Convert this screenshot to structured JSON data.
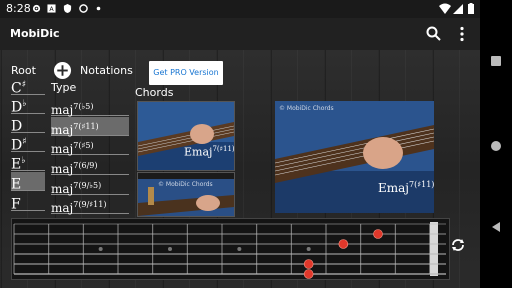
{
  "status": {
    "time": "8:28"
  },
  "app": {
    "title": "MobiDic"
  },
  "header": {
    "notations_label": "Notations",
    "pro_button": "Get PRO Version"
  },
  "roots": {
    "heading": "Root",
    "items": [
      {
        "letter": "C",
        "accidental": "♯"
      },
      {
        "letter": "D",
        "accidental": "♭"
      },
      {
        "letter": "D",
        "accidental": ""
      },
      {
        "letter": "D",
        "accidental": "♯"
      },
      {
        "letter": "E",
        "accidental": "♭"
      },
      {
        "letter": "E",
        "accidental": ""
      },
      {
        "letter": "F",
        "accidental": ""
      }
    ],
    "selected_index": 5
  },
  "types": {
    "heading": "Type",
    "items": [
      {
        "base": "maj",
        "sup": "7(♭5)"
      },
      {
        "base": "maj",
        "sup": "7(♯11)"
      },
      {
        "base": "maj",
        "sup": "7(♯5)"
      },
      {
        "base": "maj",
        "sup": "7(6/9)"
      },
      {
        "base": "maj",
        "sup": "7(9/♭5)"
      },
      {
        "base": "maj",
        "sup": "7(9/♯11)"
      }
    ],
    "selected_index": 1
  },
  "chords": {
    "heading": "Chords",
    "thumb_caption_base": "Emaj",
    "thumb_caption_sup": "7(♯11)",
    "big_caption_base": "Emaj",
    "big_caption_sup": "7(♯11)",
    "watermark": "© MobiDic Chords"
  },
  "fretboard": {
    "strings": 6,
    "frets": 12,
    "notes": [
      {
        "string": 2,
        "fret": 10
      },
      {
        "string": 3,
        "fret": 9
      },
      {
        "string": 5,
        "fret": 8
      },
      {
        "string": 6,
        "fret": 8
      }
    ]
  }
}
